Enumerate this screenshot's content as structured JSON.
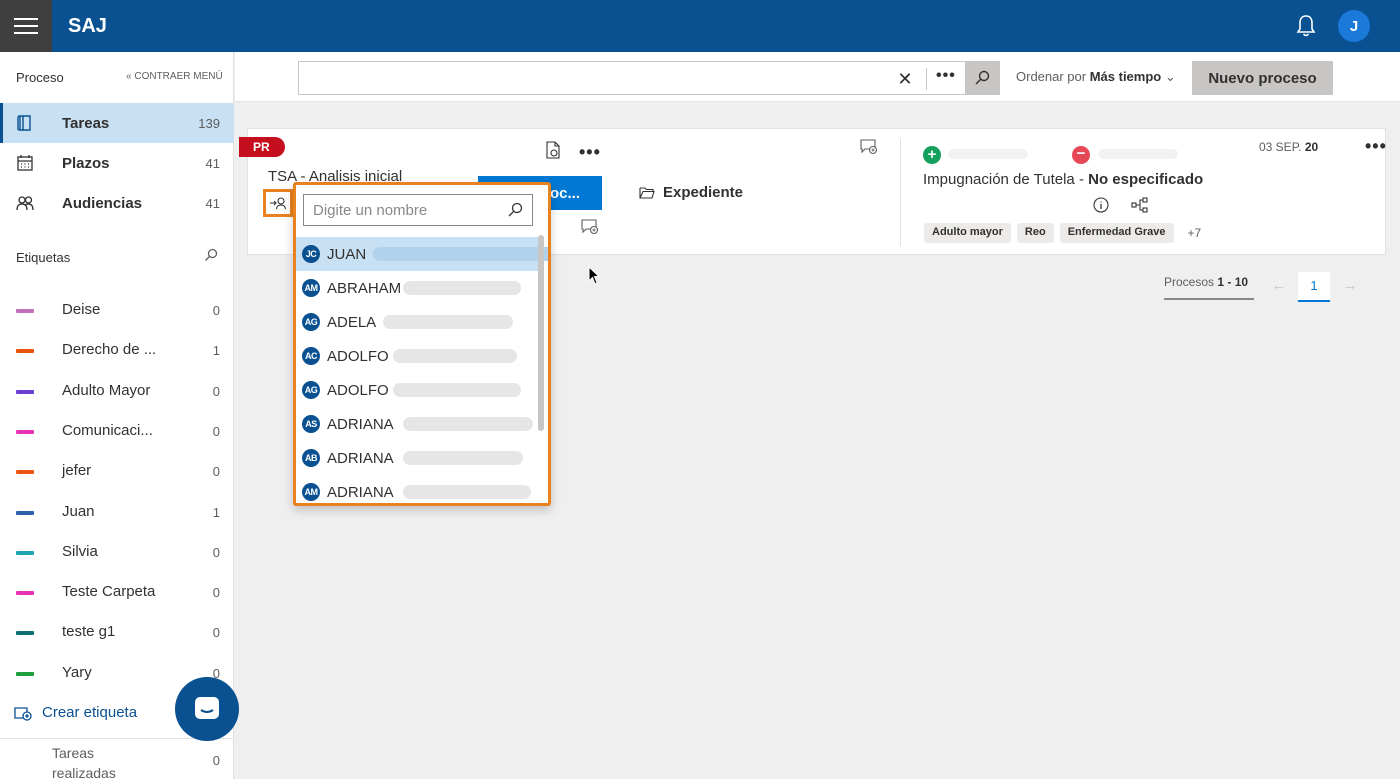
{
  "app": {
    "title": "SAJ",
    "user_initial": "J"
  },
  "sidebar": {
    "header": "Proceso",
    "collapse_label": "CONTRAER MENÚ",
    "nav": [
      {
        "label": "Tareas",
        "count": "139",
        "icon": "book-icon"
      },
      {
        "label": "Plazos",
        "count": "41",
        "icon": "calendar-icon"
      },
      {
        "label": "Audiencias",
        "count": "41",
        "icon": "people-icon"
      }
    ],
    "tags_header": "Etiquetas",
    "tags": [
      {
        "label": "Deise",
        "count": "0",
        "color": "#c36fbc"
      },
      {
        "label": "Derecho de ...",
        "count": "1",
        "color": "#e9540f"
      },
      {
        "label": "Adulto Mayor",
        "count": "0",
        "color": "#6b3fd1"
      },
      {
        "label": "Comunicaci...",
        "count": "0",
        "color": "#e633b4"
      },
      {
        "label": "jefer",
        "count": "0",
        "color": "#e9540f"
      },
      {
        "label": "Juan",
        "count": "1",
        "color": "#2f5fad"
      },
      {
        "label": "Silvia",
        "count": "0",
        "color": "#1fa6b3"
      },
      {
        "label": "Teste Carpeta",
        "count": "0",
        "color": "#e633b4"
      },
      {
        "label": "teste g1",
        "count": "0",
        "color": "#0e6e73"
      },
      {
        "label": "Yary",
        "count": "0",
        "color": "#1f9e3e"
      }
    ],
    "create_tag": "Crear etiqueta",
    "done_tasks": {
      "label": "Tareas realizadas",
      "count": "0"
    }
  },
  "toolbar": {
    "search_value": "",
    "sort_prefix": "Ordenar por",
    "sort_value": "Más tiempo",
    "new_process": "Nuevo proceso"
  },
  "card": {
    "badge": "PR",
    "task_title": "TSA - Analisis inicial",
    "action_button": "oc...",
    "expediente": "Expediente",
    "date_day": "03 SEP.",
    "date_year": "20",
    "process_title": "Impugnación de Tutela",
    "process_status": "No especificado",
    "chips": [
      "Adulto mayor",
      "Reo",
      "Enfermedad Grave"
    ],
    "chips_more": "+7"
  },
  "pagination": {
    "label_prefix": "Procesos",
    "range": "1 - 10",
    "current_page": "1"
  },
  "assign_dropdown": {
    "placeholder": "Digite un nombre",
    "users": [
      {
        "initials": "JC",
        "name": "JUAN"
      },
      {
        "initials": "AM",
        "name": "ABRAHAM"
      },
      {
        "initials": "AG",
        "name": "ADELA"
      },
      {
        "initials": "AC",
        "name": "ADOLFO"
      },
      {
        "initials": "AG",
        "name": "ADOLFO"
      },
      {
        "initials": "AS",
        "name": "ADRIANA"
      },
      {
        "initials": "AB",
        "name": "ADRIANA"
      },
      {
        "initials": "AM",
        "name": "ADRIANA"
      }
    ]
  }
}
